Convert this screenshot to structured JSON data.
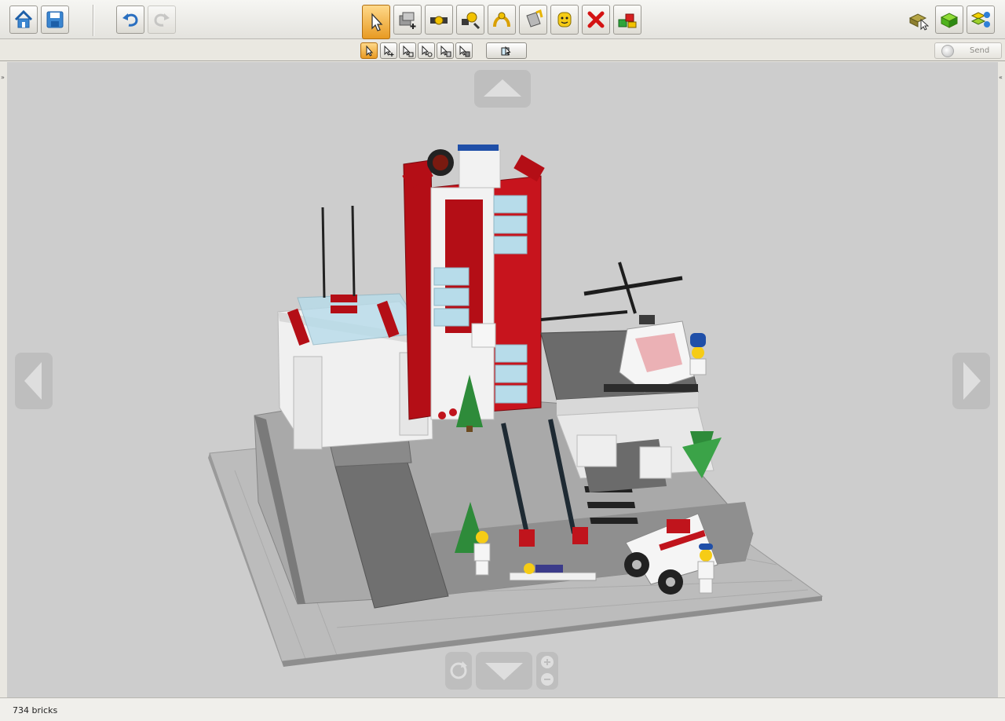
{
  "toolbar": {
    "left_buttons": [
      {
        "name": "home-button",
        "icon": "home-icon"
      },
      {
        "name": "save-button",
        "icon": "floppy-disk-icon"
      },
      {
        "name": "undo-button",
        "icon": "undo-icon"
      },
      {
        "name": "redo-button",
        "icon": "redo-icon",
        "disabled": true
      }
    ],
    "tools": [
      {
        "name": "select-tool",
        "icon": "cursor-icon",
        "active": true
      },
      {
        "name": "clone-tool",
        "icon": "clone-brick-icon"
      },
      {
        "name": "hinge-tool",
        "icon": "hinge-icon"
      },
      {
        "name": "hinge-align-tool",
        "icon": "hinge-align-icon"
      },
      {
        "name": "flex-tool",
        "icon": "flex-icon"
      },
      {
        "name": "paint-tool",
        "icon": "paint-bucket-icon"
      },
      {
        "name": "decoration-tool",
        "icon": "minifig-head-icon"
      },
      {
        "name": "delete-tool",
        "icon": "red-x-icon"
      },
      {
        "name": "hide-tool",
        "icon": "hide-bricks-icon"
      }
    ],
    "modes": [
      {
        "name": "build-mode",
        "icon": "build-mode-icon"
      },
      {
        "name": "view-mode",
        "icon": "view-mode-icon"
      },
      {
        "name": "building-guide-mode",
        "icon": "building-guide-icon"
      }
    ]
  },
  "subbar": {
    "select_modes": [
      {
        "name": "single-select",
        "icon": "cursor-single-icon",
        "active": true
      },
      {
        "name": "multi-select",
        "icon": "cursor-plus-icon"
      },
      {
        "name": "connected-select",
        "icon": "cursor-connected-icon"
      },
      {
        "name": "color-select",
        "icon": "cursor-color-icon"
      },
      {
        "name": "shape-select",
        "icon": "cursor-shape-icon"
      },
      {
        "name": "color-shape-select",
        "icon": "cursor-color-shape-icon"
      }
    ],
    "invert_icon": "invert-selection-icon",
    "send_label": "Send"
  },
  "viewport": {
    "nav": [
      "camera-up-arrow",
      "camera-left-arrow",
      "camera-right-arrow",
      "camera-down-arrow"
    ],
    "zoom_icons": [
      "reset-view-icon",
      "zoom-in-icon",
      "zoom-out-icon"
    ],
    "colors": {
      "background": "#cdcdcd",
      "baseplate": "#bfbfbf",
      "brick_red": "#b40e16",
      "brick_white": "#f2f2f2",
      "dark_gray": "#6f6f6f",
      "green": "#2e8b3a"
    }
  },
  "status": {
    "brick_count": "734 bricks"
  }
}
